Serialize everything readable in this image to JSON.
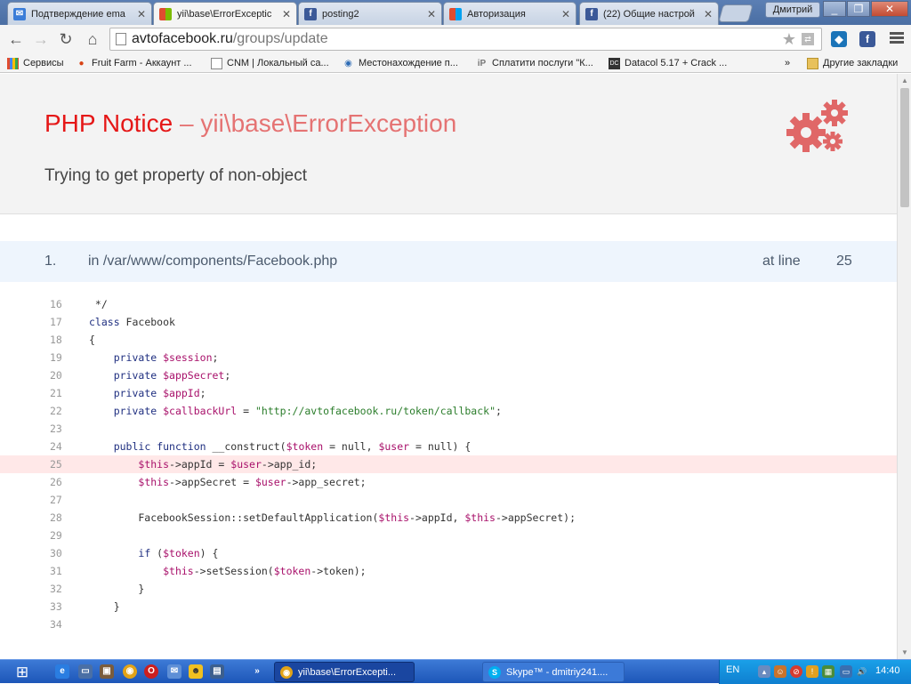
{
  "browser": {
    "tabs": [
      {
        "title": "Подтверждение ema",
        "icon": "mail-icon",
        "color": "#3b7dd8"
      },
      {
        "title": "yii\\base\\ErrorExceptic",
        "icon": "windows-logo-icon",
        "color": "#e04c2f"
      },
      {
        "title": "posting2",
        "icon": "facebook-icon",
        "color": "#3b5998"
      },
      {
        "title": "Авторизация",
        "icon": "windows-logo-icon",
        "color": "#e04c2f"
      },
      {
        "title": "(22) Общие настрой",
        "icon": "facebook-icon",
        "color": "#3b5998"
      }
    ],
    "user": "Дмитрий",
    "url_host": "avtofacebook.ru",
    "url_path": "/groups/update",
    "bookmarks": [
      {
        "label": "Сервисы",
        "icon": "apps-icon"
      },
      {
        "label": "Fruit Farm - Аккаунт ...",
        "icon": "fruit-icon"
      },
      {
        "label": "CNM | Локальный са...",
        "icon": "page-icon"
      },
      {
        "label": "Местонахождение п...",
        "icon": "globe-icon"
      },
      {
        "label": "Сплатити послуги \"К...",
        "icon": "ip-icon"
      },
      {
        "label": "Datacol 5.17 + Crack ...",
        "icon": "datacol-icon"
      }
    ],
    "bookmarks_more": "»",
    "other_bookmarks": "Другие закладки"
  },
  "error": {
    "type": "PHP Notice",
    "separator": " – ",
    "class": "yii\\base\\ErrorException",
    "message": "Trying to get property of non-object"
  },
  "callstack": {
    "number": "1.",
    "file": "in /var/www/components/Facebook.php",
    "at_label": "at line",
    "line": "25"
  },
  "code": {
    "error_line": 25,
    "lines": [
      {
        "n": "16",
        "src": " */"
      },
      {
        "n": "17",
        "src": "class Facebook"
      },
      {
        "n": "18",
        "src": "{"
      },
      {
        "n": "19",
        "src": "    private $session;"
      },
      {
        "n": "20",
        "src": "    private $appSecret;"
      },
      {
        "n": "21",
        "src": "    private $appId;"
      },
      {
        "n": "22",
        "src": "    private $callbackUrl = \"http://avtofacebook.ru/token/callback\";"
      },
      {
        "n": "23",
        "src": ""
      },
      {
        "n": "24",
        "src": "    public function __construct($token = null, $user = null) {"
      },
      {
        "n": "25",
        "src": "        $this->appId = $user->app_id;"
      },
      {
        "n": "26",
        "src": "        $this->appSecret = $user->app_secret;"
      },
      {
        "n": "27",
        "src": ""
      },
      {
        "n": "28",
        "src": "        FacebookSession::setDefaultApplication($this->appId, $this->appSecret);"
      },
      {
        "n": "29",
        "src": ""
      },
      {
        "n": "30",
        "src": "        if ($token) {"
      },
      {
        "n": "31",
        "src": "            $this->setSession($token->token);"
      },
      {
        "n": "32",
        "src": "        }"
      },
      {
        "n": "33",
        "src": "    }"
      },
      {
        "n": "34",
        "src": ""
      }
    ]
  },
  "taskbar": {
    "tasks": [
      {
        "label": "yii\\base\\ErrorExcepti...",
        "icon": "chrome-icon"
      },
      {
        "label": "Skype™ - dmitriy241....",
        "icon": "skype-icon"
      }
    ],
    "more": "»",
    "lang": "EN",
    "clock": "14:40"
  },
  "colors": {
    "error_red": "#e51717",
    "class_red": "#e57373",
    "callstack_bg": "#eef5fd",
    "error_line_bg": "#ffe8e8"
  }
}
